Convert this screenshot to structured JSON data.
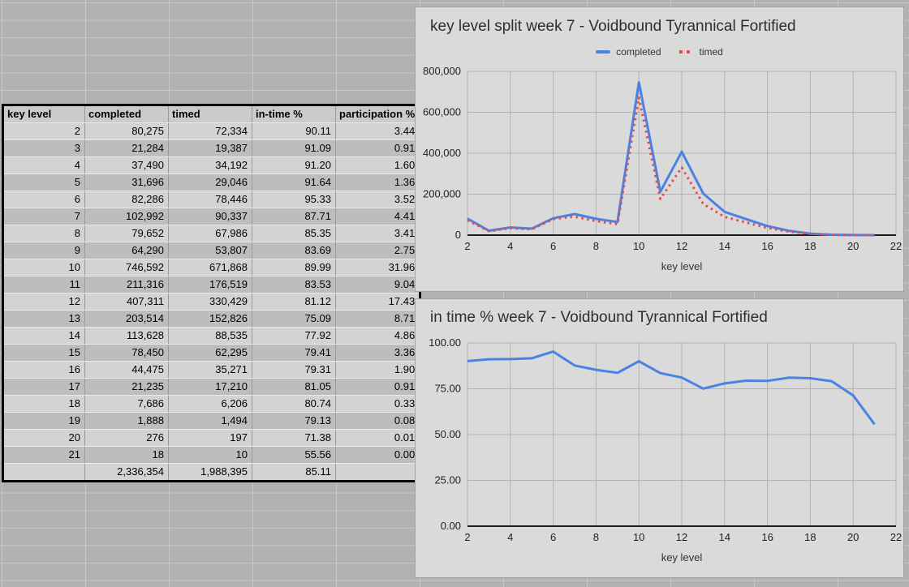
{
  "table": {
    "headers": [
      "key level",
      "completed",
      "timed",
      "in-time %",
      "participation %"
    ],
    "rows": [
      [
        "2",
        "80,275",
        "72,334",
        "90.11",
        "3.44"
      ],
      [
        "3",
        "21,284",
        "19,387",
        "91.09",
        "0.91"
      ],
      [
        "4",
        "37,490",
        "34,192",
        "91.20",
        "1.60"
      ],
      [
        "5",
        "31,696",
        "29,046",
        "91.64",
        "1.36"
      ],
      [
        "6",
        "82,286",
        "78,446",
        "95.33",
        "3.52"
      ],
      [
        "7",
        "102,992",
        "90,337",
        "87.71",
        "4.41"
      ],
      [
        "8",
        "79,652",
        "67,986",
        "85.35",
        "3.41"
      ],
      [
        "9",
        "64,290",
        "53,807",
        "83.69",
        "2.75"
      ],
      [
        "10",
        "746,592",
        "671,868",
        "89.99",
        "31.96"
      ],
      [
        "11",
        "211,316",
        "176,519",
        "83.53",
        "9.04"
      ],
      [
        "12",
        "407,311",
        "330,429",
        "81.12",
        "17.43"
      ],
      [
        "13",
        "203,514",
        "152,826",
        "75.09",
        "8.71"
      ],
      [
        "14",
        "113,628",
        "88,535",
        "77.92",
        "4.86"
      ],
      [
        "15",
        "78,450",
        "62,295",
        "79.41",
        "3.36"
      ],
      [
        "16",
        "44,475",
        "35,271",
        "79.31",
        "1.90"
      ],
      [
        "17",
        "21,235",
        "17,210",
        "81.05",
        "0.91"
      ],
      [
        "18",
        "7,686",
        "6,206",
        "80.74",
        "0.33"
      ],
      [
        "19",
        "1,888",
        "1,494",
        "79.13",
        "0.08"
      ],
      [
        "20",
        "276",
        "197",
        "71.38",
        "0.01"
      ],
      [
        "21",
        "18",
        "10",
        "55.56",
        "0.00"
      ]
    ],
    "total_row": [
      "",
      "2,336,354",
      "1,988,395",
      "85.11",
      ""
    ]
  },
  "chart_data": [
    {
      "type": "line",
      "title": "key level split week 7 - Voidbound Tyrannical Fortified",
      "xlabel": "key level",
      "x": [
        2,
        3,
        4,
        5,
        6,
        7,
        8,
        9,
        10,
        11,
        12,
        13,
        14,
        15,
        16,
        17,
        18,
        19,
        20,
        21
      ],
      "series": [
        {
          "name": "completed",
          "style": "solid",
          "color": "#4a82e4",
          "values": [
            80275,
            21284,
            37490,
            31696,
            82286,
            102992,
            79652,
            64290,
            746592,
            211316,
            407311,
            203514,
            113628,
            78450,
            44475,
            21235,
            7686,
            1888,
            276,
            18
          ]
        },
        {
          "name": "timed",
          "style": "dotted",
          "color": "#e25045",
          "values": [
            72334,
            19387,
            34192,
            29046,
            78446,
            90337,
            67986,
            53807,
            671868,
            176519,
            330429,
            152826,
            88535,
            62295,
            35271,
            17210,
            6206,
            1494,
            197,
            10
          ]
        }
      ],
      "xlim": [
        2,
        22
      ],
      "ylim": [
        0,
        800000
      ],
      "xticks": [
        2,
        4,
        6,
        8,
        10,
        12,
        14,
        16,
        18,
        20,
        22
      ],
      "ytick_values": [
        0,
        200000,
        400000,
        600000,
        800000
      ],
      "ytick_labels": [
        "0",
        "200,000",
        "400,000",
        "600,000",
        "800,000"
      ],
      "legend": true,
      "legend_position": "top",
      "grid": true
    },
    {
      "type": "line",
      "title": "in time % week 7 - Voidbound Tyrannical Fortified",
      "xlabel": "key level",
      "x": [
        2,
        3,
        4,
        5,
        6,
        7,
        8,
        9,
        10,
        11,
        12,
        13,
        14,
        15,
        16,
        17,
        18,
        19,
        20,
        21
      ],
      "series": [
        {
          "name": "in-time %",
          "style": "solid",
          "color": "#4a82e4",
          "values": [
            90.11,
            91.09,
            91.2,
            91.64,
            95.33,
            87.71,
            85.35,
            83.69,
            89.99,
            83.53,
            81.12,
            75.09,
            77.92,
            79.41,
            79.31,
            81.05,
            80.74,
            79.13,
            71.38,
            55.56
          ]
        }
      ],
      "xlim": [
        2,
        22
      ],
      "ylim": [
        0,
        100
      ],
      "xticks": [
        2,
        4,
        6,
        8,
        10,
        12,
        14,
        16,
        18,
        20,
        22
      ],
      "ytick_values": [
        0,
        25,
        50,
        75,
        100
      ],
      "ytick_labels": [
        "0.00",
        "25.00",
        "50.00",
        "75.00",
        "100.00"
      ],
      "legend": false,
      "grid": true
    }
  ],
  "colors": {
    "series_blue": "#4a82e4",
    "series_red": "#e25045",
    "sheet_background": "#b1b1b1",
    "panel_background": "#dadada",
    "table_band_light": "#d3d3d3",
    "table_band_dark": "#bdbdbd"
  }
}
